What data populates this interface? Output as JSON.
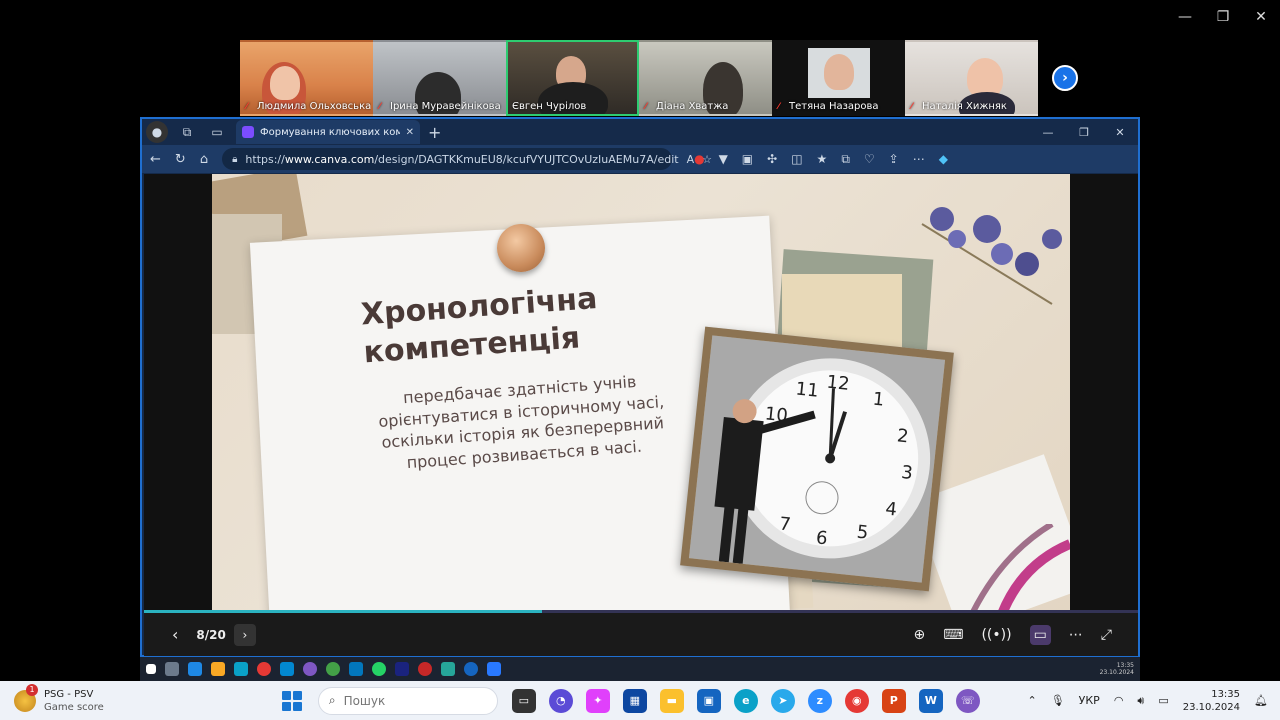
{
  "zoom_window": {
    "controls": [
      "—",
      "❐",
      "✕"
    ]
  },
  "participants": [
    {
      "name": "Людмила Ольховська",
      "bg": "#d9824a"
    },
    {
      "name": "Ірина Муравейнікова",
      "bg": "#8a8d92"
    },
    {
      "name": "Євген Чуріл ов",
      "bg": "#3d3a35",
      "active": true
    },
    {
      "name": "Діана Хватжа",
      "bg": "#9b9c94"
    },
    {
      "name": "Тетяна Назарова",
      "bg": "#e8eaec"
    },
    {
      "name": "Наталія Хижняк",
      "bg": "#d9d4ce"
    }
  ],
  "browser": {
    "tab_title": "Формування ключових компете",
    "url_prefix": "https://",
    "url_domain": "www.canva.com",
    "url_path": "/design/DAGTKKmuEU8/kcufVYUJTCOvUzIuAEMu7A/edit",
    "window_controls": [
      "—",
      "❐",
      "✕"
    ]
  },
  "slide": {
    "title": "Хронологічна компетенція",
    "body": "передбачає здатність учнів орієнтуватися в історичному часі, оскільки історія як безперервний процес розвивається в часі."
  },
  "presenter": {
    "page_indicator": "8/20",
    "progress": 0.4
  },
  "remote_clock": {
    "time": "13:35",
    "date": "23.10.2024"
  },
  "taskbar": {
    "game_title": "PSG - PSV",
    "game_sub": "Game score",
    "game_badge": "1",
    "search_placeholder": "Пошук",
    "lang": "УКР",
    "time": "13:35",
    "date": "23.10.2024"
  }
}
